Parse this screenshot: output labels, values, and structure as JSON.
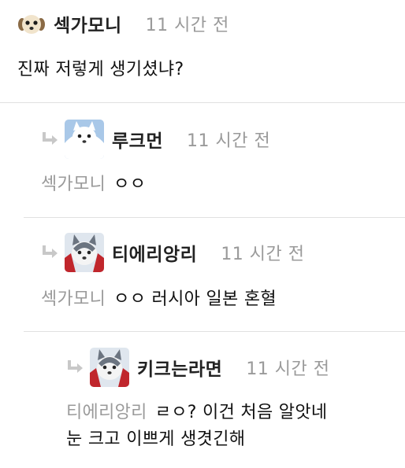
{
  "comments": [
    {
      "author": "섹가모니",
      "time": "11 시간 전",
      "mention": "",
      "text": "진짜 저렇게 생기셨냐?",
      "avatar_icon": "dog-avatar-icon"
    },
    {
      "author": "루크먼",
      "time": "11 시간 전",
      "mention": "섹가모니",
      "text": "ㅇㅇ",
      "avatar_icon": "white-dog-avatar-icon"
    },
    {
      "author": "티에리앙리",
      "time": "11 시간 전",
      "mention": "섹가모니",
      "text": "ㅇㅇ 러시아 일본 혼혈",
      "avatar_icon": "husky-avatar-icon"
    },
    {
      "author": "키크는라면",
      "time": "11 시간 전",
      "mention": "티에리앙리",
      "text": "ㄹㅇ? 이건 처음 알앗네\n눈 크고 이쁘게 생겻긴해",
      "avatar_icon": "husky-avatar-icon"
    }
  ],
  "colors": {
    "author": "#222222",
    "meta": "#9a9a9a",
    "divider": "#e1e1e1",
    "reply_arrow": "#c8c8c8"
  }
}
